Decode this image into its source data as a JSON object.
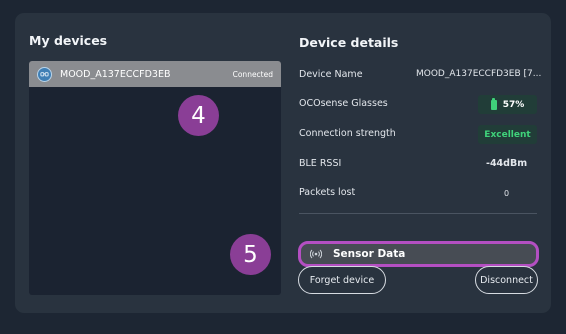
{
  "my_devices": {
    "title": "My devices",
    "items": [
      {
        "name": "MOOD_A137ECCFD3EB",
        "status": "Connected",
        "icon": "glasses-icon"
      }
    ]
  },
  "device_details": {
    "title": "Device details",
    "rows": [
      {
        "label": "Device Name",
        "value": "MOOD_A137ECCFD3EB [7..."
      },
      {
        "label": "OCOsense Glasses",
        "value": "57%",
        "icon": "battery-icon",
        "battery_level": 0.57
      },
      {
        "label": "Connection strength",
        "value": "Excellent"
      },
      {
        "label": "BLE RSSI",
        "value": "-44dBm"
      },
      {
        "label": "Packets lost",
        "value": "0"
      }
    ]
  },
  "actions": {
    "sensor_data": "Sensor Data",
    "sensor_icon": "signal-icon",
    "forget": "Forget device",
    "disconnect": "Disconnect"
  },
  "markers": {
    "m4": "4",
    "m5": "5"
  },
  "colors": {
    "background": "#1d2633",
    "panel": "#29333f",
    "list_bg": "#1b2331",
    "selected_row": "#8a8c90",
    "success": "#3fd27a",
    "badge_bg": "#213d38",
    "highlight": "#b44fc2",
    "marker": "#8a3e96"
  }
}
